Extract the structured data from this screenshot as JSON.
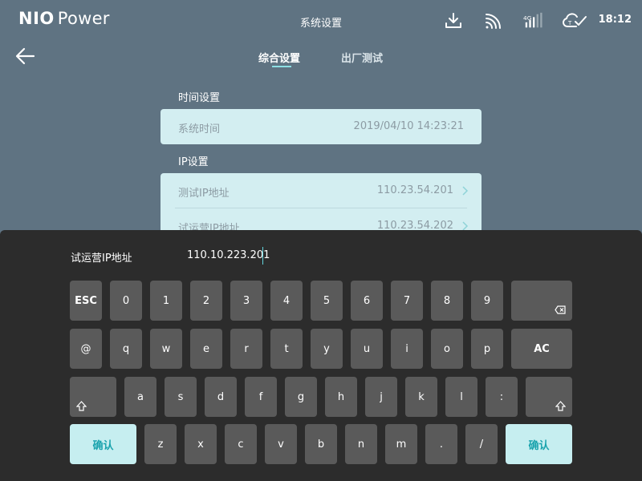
{
  "status_bar": {
    "brand_bold": "NIO",
    "brand_light": "Power",
    "title": "系统设置",
    "time": "18:12",
    "icons": [
      "download-icon",
      "wifi-icon",
      "signal-icon",
      "cloud-check-icon"
    ]
  },
  "tabs": [
    {
      "label": "综合设置",
      "active": true
    },
    {
      "label": "出厂测试",
      "active": false
    }
  ],
  "sections": {
    "time": {
      "title": "时间设置",
      "rows": [
        {
          "label": "系统时间",
          "value": "2019/04/10  14:23:21"
        }
      ]
    },
    "ip": {
      "title": "IP设置",
      "rows": [
        {
          "label": "测试IP地址",
          "value": "110.23.54.201"
        },
        {
          "label": "试运营IP地址",
          "value": "110.23.54.202"
        }
      ]
    }
  },
  "keyboard": {
    "input_label": "试运营IP地址",
    "input_value": "110.10.223.201",
    "row1": [
      "ESC",
      "0",
      "1",
      "2",
      "3",
      "4",
      "5",
      "6",
      "7",
      "8",
      "9"
    ],
    "row2": [
      "@",
      "q",
      "w",
      "e",
      "r",
      "t",
      "y",
      "u",
      "i",
      "o",
      "p",
      "AC"
    ],
    "row3": [
      "a",
      "s",
      "d",
      "f",
      "g",
      "h",
      "j",
      "k",
      "l",
      ":"
    ],
    "row4": [
      "z",
      "x",
      "c",
      "v",
      "b",
      "n",
      "m",
      ".",
      "/"
    ],
    "confirm_label": "确认",
    "accent_color": "#c6eef0"
  },
  "colors": {
    "background": "#5f7382",
    "card": "#d3eef1",
    "keyboard_bg": "#2c2c2c",
    "key": "#5a5a5a",
    "accent": "#1aa3ad"
  }
}
